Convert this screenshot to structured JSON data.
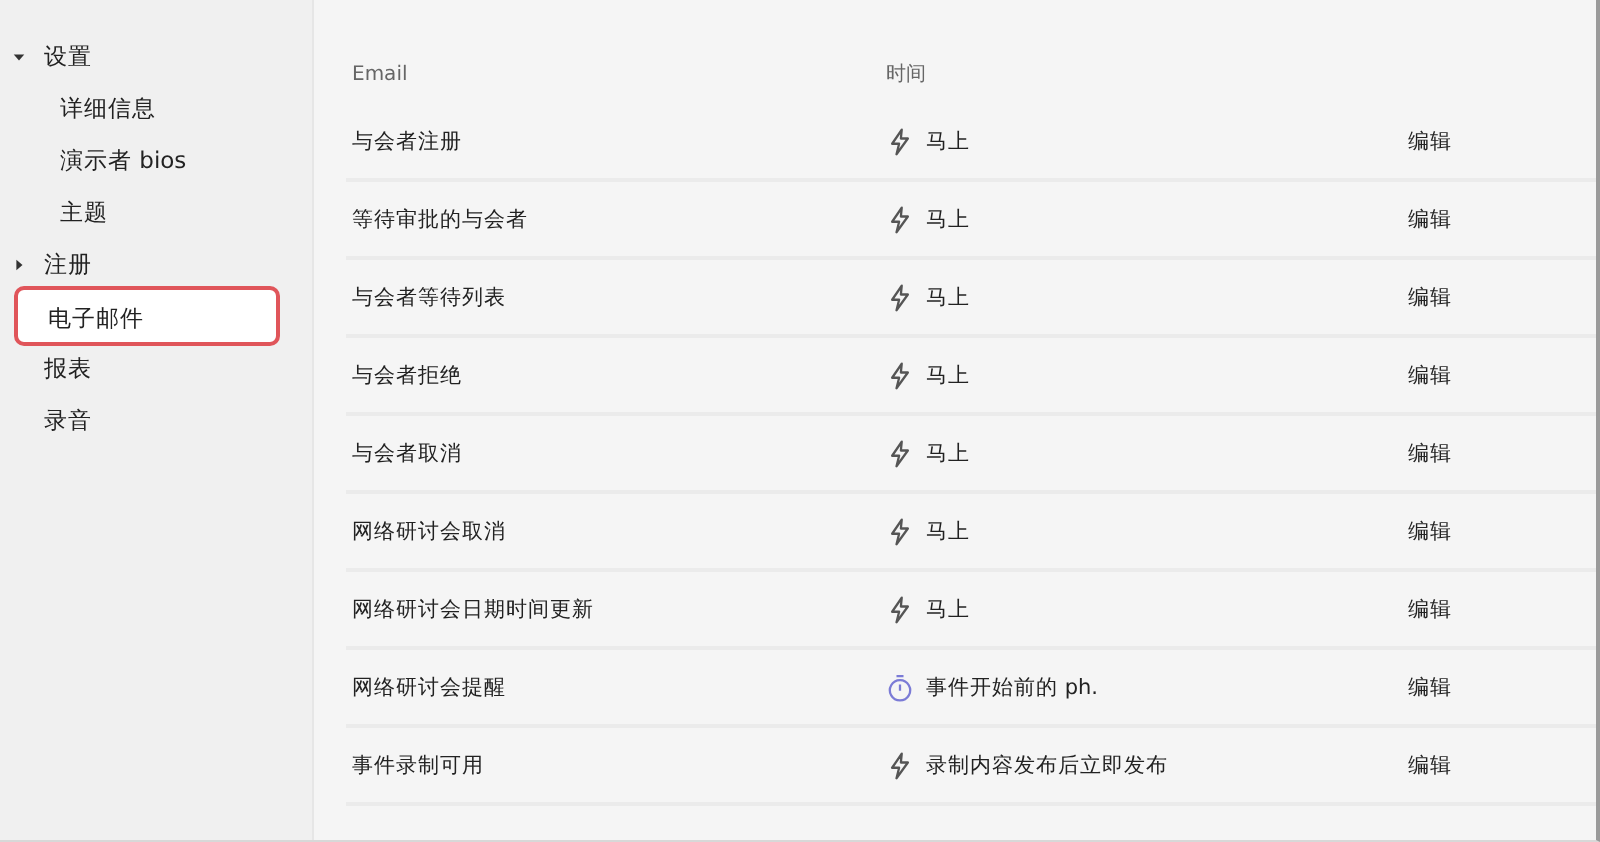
{
  "sidebar": {
    "items": [
      {
        "label": "设置",
        "expanded": true,
        "selected": false,
        "children": [
          {
            "label": "详细信息",
            "selected": false
          },
          {
            "label": "演示者 bios",
            "selected": false
          },
          {
            "label": "主题",
            "selected": false
          }
        ]
      },
      {
        "label": "注册",
        "expanded": false,
        "selected": false
      },
      {
        "label": "电子邮件",
        "selected": true
      },
      {
        "label": "报表",
        "selected": false
      },
      {
        "label": "录音",
        "selected": false
      }
    ]
  },
  "table": {
    "columns": [
      "Email",
      "时间"
    ],
    "rows": [
      {
        "email": "与会者注册",
        "kind": "instant",
        "time": "马上",
        "action": "编辑"
      },
      {
        "email": "等待审批的与会者",
        "kind": "instant",
        "time": "马上",
        "action": "编辑"
      },
      {
        "email": "与会者等待列表",
        "kind": "instant",
        "time": "马上",
        "action": "编辑"
      },
      {
        "email": "与会者拒绝",
        "kind": "instant",
        "time": "马上",
        "action": "编辑"
      },
      {
        "email": "与会者取消",
        "kind": "instant",
        "time": "马上",
        "action": "编辑"
      },
      {
        "email": "网络研讨会取消",
        "kind": "instant",
        "time": "马上",
        "action": "编辑"
      },
      {
        "email": "网络研讨会日期时间更新",
        "kind": "instant",
        "time": "马上",
        "action": "编辑"
      },
      {
        "email": "网络研讨会提醒",
        "kind": "timer",
        "time": "事件开始前的 ph.",
        "action": "编辑"
      },
      {
        "email": "事件录制可用",
        "kind": "instant",
        "time": "录制内容发布后立即发布",
        "action": "编辑"
      }
    ]
  }
}
